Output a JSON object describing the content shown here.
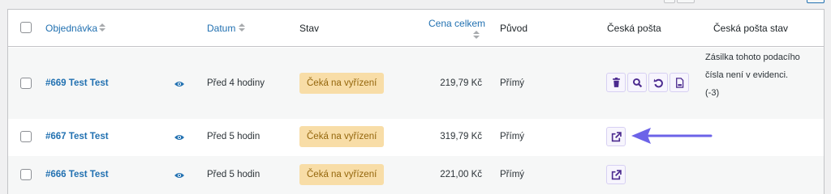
{
  "columns": {
    "order": "Objednávka",
    "date": "Datum",
    "status": "Stav",
    "total": "Cena celkem",
    "origin": "Původ",
    "ceska_posta": "Česká pošta",
    "ceska_posta_status": "Česká pošta stav"
  },
  "rows": [
    {
      "order": "#669 Test Test",
      "date": "Před 4 hodiny",
      "status": "Čeká na vyřízení",
      "total": "219,79 Kč",
      "origin": "Přímý",
      "actions": [
        "trash-icon",
        "search-icon",
        "refresh-icon",
        "document-icon"
      ],
      "cp_status": "Zásilka tohoto podacího čísla není v evidenci. (-3)"
    },
    {
      "order": "#667 Test Test",
      "date": "Před 5 hodin",
      "status": "Čeká na vyřízení",
      "total": "319,79 Kč",
      "origin": "Přímý",
      "actions": [
        "external-link-icon"
      ],
      "cp_status": ""
    },
    {
      "order": "#666 Test Test",
      "date": "Před 5 hodin",
      "status": "Čeká na vyřízení",
      "total": "221,00 Kč",
      "origin": "Přímý",
      "actions": [
        "external-link-icon"
      ],
      "cp_status": ""
    }
  ],
  "colors": {
    "link": "#2271b1",
    "badge_bg": "#f8dda7",
    "badge_text": "#94660c",
    "action_icon": "#4b2a8f",
    "arrow": "#6c63e8"
  }
}
